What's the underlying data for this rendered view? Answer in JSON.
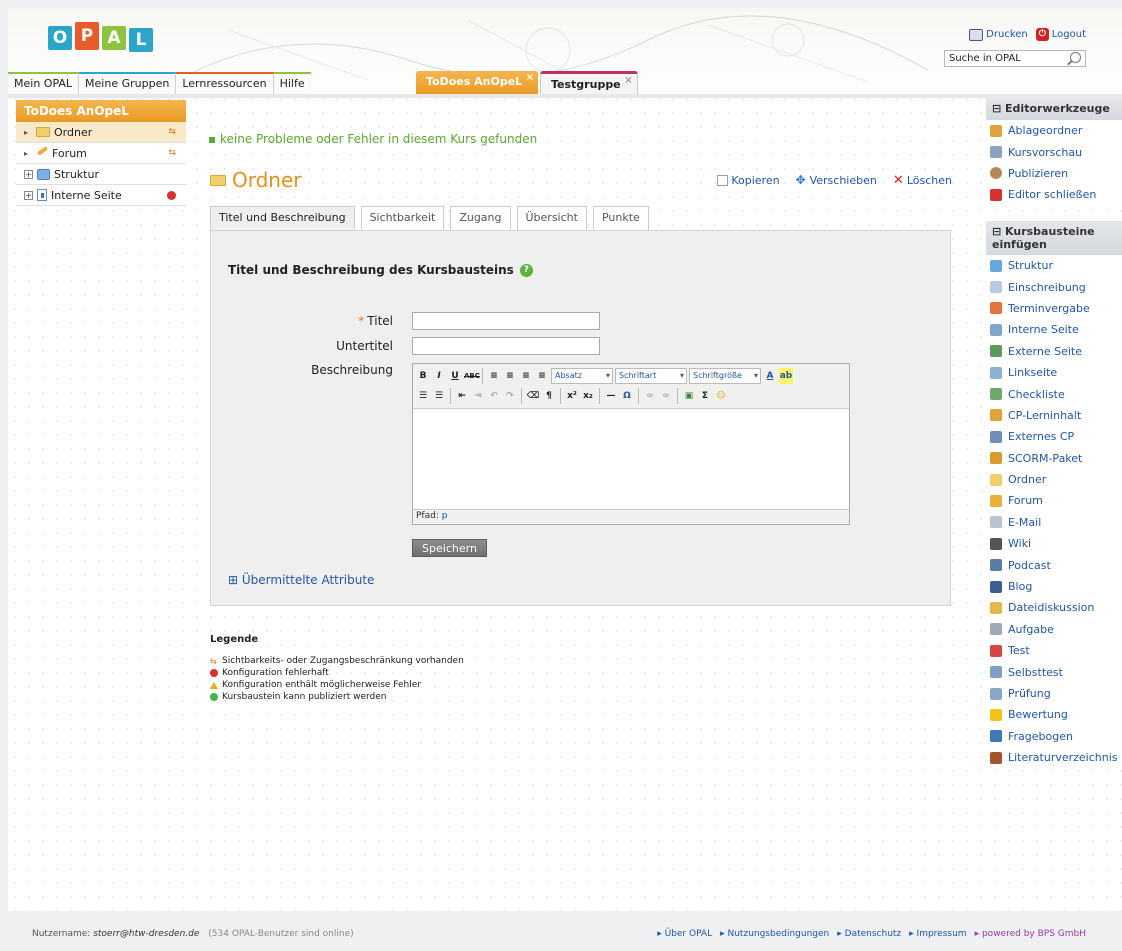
{
  "header": {
    "logo_letters": [
      "O",
      "P",
      "A",
      "L"
    ],
    "print_label": "Drucken",
    "logout_label": "Logout",
    "search_value": "Suche in OPAL"
  },
  "nav": {
    "items": [
      "Mein OPAL",
      "Meine Gruppen",
      "Lernressourcen",
      "Hilfe"
    ]
  },
  "course_tabs": {
    "active": "ToDoes AnOpeL",
    "other": "Testgruppe",
    "close_glyph": "×"
  },
  "course_menu": {
    "title": "ToDoes AnOpeL",
    "items": [
      {
        "label": "Ordner"
      },
      {
        "label": "Forum"
      },
      {
        "label": "Struktur"
      },
      {
        "label": "Interne Seite"
      }
    ]
  },
  "main": {
    "message": "keine Probleme oder Fehler in diesem Kurs gefunden",
    "node_title": "Ordner",
    "actions": {
      "copy": "Kopieren",
      "move": "Verschieben",
      "delete": "Löschen"
    },
    "tabs": [
      "Titel und Beschreibung",
      "Sichtbarkeit",
      "Zugang",
      "Übersicht",
      "Punkte"
    ],
    "panel_title": "Titel und Beschreibung des Kursbausteins",
    "form": {
      "title_label": "Titel",
      "title_value": "",
      "subtitle_label": "Untertitel",
      "subtitle_value": "",
      "description_label": "Beschreibung"
    },
    "editor": {
      "format_select": "Absatz",
      "font_select": "Schriftart",
      "size_select": "Schriftgröße",
      "path_label": "Pfad:",
      "path_value": "p"
    },
    "save_label": "Speichern",
    "attributes_link": "Übermittelte Attribute"
  },
  "legend": {
    "title": "Legende",
    "items": [
      "Sichtbarkeits- oder Zugangsbeschränkung vorhanden",
      "Konfiguration fehlerhaft",
      "Konfiguration enthält möglicherweise Fehler",
      "Kursbaustein kann publiziert werden"
    ]
  },
  "sidebar": {
    "editor_tools_title": "Editorwerkzeuge",
    "editor_tools": [
      "Ablageordner",
      "Kursvorschau",
      "Publizieren",
      "Editor schließen"
    ],
    "insert_title": "Kursbausteine einfügen",
    "insert_items": [
      {
        "label": "Struktur",
        "color": "#6aa6de"
      },
      {
        "label": "Einschreibung",
        "color": "#b9cbe0"
      },
      {
        "label": "Terminvergabe",
        "color": "#e8733a"
      },
      {
        "label": "Interne Seite",
        "color": "#7ea7cf"
      },
      {
        "label": "Externe Seite",
        "color": "#5b9c5b"
      },
      {
        "label": "Linkseite",
        "color": "#8cb0d6"
      },
      {
        "label": "Checkliste",
        "color": "#6ea86e"
      },
      {
        "label": "CP-Lerninhalt",
        "color": "#e0a23a"
      },
      {
        "label": "Externes CP",
        "color": "#6f8fb8"
      },
      {
        "label": "SCORM-Paket",
        "color": "#d99a2e"
      },
      {
        "label": "Ordner",
        "color": "#f1cf6a"
      },
      {
        "label": "Forum",
        "color": "#e7b03a"
      },
      {
        "label": "E-Mail",
        "color": "#b9c3d2"
      },
      {
        "label": "Wiki",
        "color": "#555555"
      },
      {
        "label": "Podcast",
        "color": "#5a7ca8"
      },
      {
        "label": "Blog",
        "color": "#3d5f91"
      },
      {
        "label": "Dateidiskussion",
        "color": "#e2b84a"
      },
      {
        "label": "Aufgabe",
        "color": "#9fa9b5"
      },
      {
        "label": "Test",
        "color": "#d74545"
      },
      {
        "label": "Selbsttest",
        "color": "#7f9fc4"
      },
      {
        "label": "Prüfung",
        "color": "#8aa6c5"
      },
      {
        "label": "Bewertung",
        "color": "#f2c21b"
      },
      {
        "label": "Fragebogen",
        "color": "#3d78b8"
      },
      {
        "label": "Literaturverzeichnis",
        "color": "#a5522d"
      }
    ]
  },
  "footer": {
    "user_label": "Nutzername:",
    "user_email": "stoerr@htw-dresden.de",
    "online": "(534 OPAL-Benutzer sind online)",
    "links": [
      "Über OPAL",
      "Nutzungsbedingungen",
      "Datenschutz",
      "Impressum"
    ],
    "powered": "powered by BPS GmbH"
  }
}
